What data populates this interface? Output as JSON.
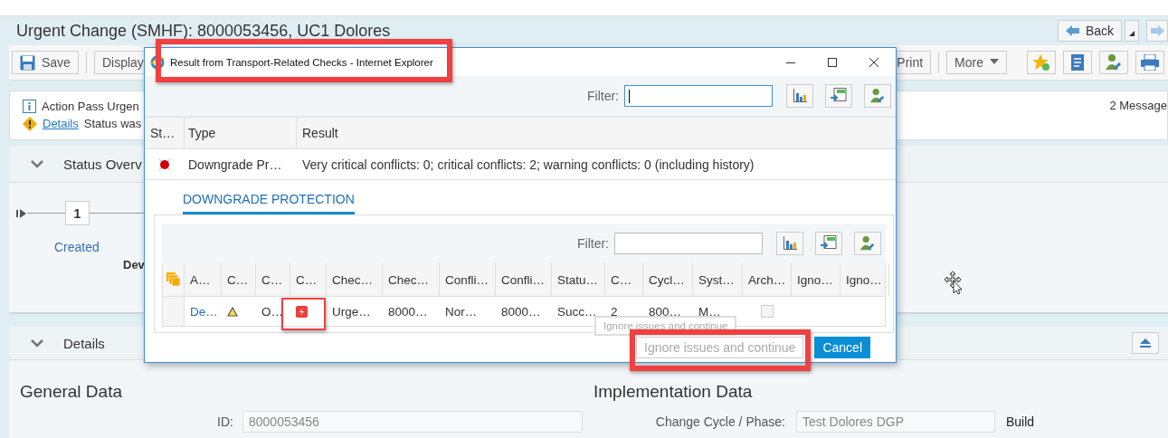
{
  "page": {
    "title": "Urgent Change (SMHF): 8000053456, UC1 Dolores",
    "navigation": {
      "back": "Back"
    },
    "toolbar": {
      "left": [
        {
          "label": "Save",
          "kind": "save"
        },
        {
          "label": "Display",
          "kind": "plain"
        }
      ],
      "right": [
        {
          "label": "Print",
          "kind": "plain"
        },
        {
          "label": "More",
          "kind": "menu"
        }
      ]
    },
    "messages": {
      "items": [
        {
          "kind": "info",
          "text": "Action Pass Urgen"
        },
        {
          "kind": "warning",
          "link": "Details",
          "text": "Status was"
        }
      ],
      "count": "2 Message"
    },
    "status_overview": {
      "title": "Status Overv",
      "expanded": true,
      "steps": [
        {
          "number": "1",
          "label": "Created"
        }
      ],
      "phase": "Dev"
    },
    "details": {
      "title": "Details",
      "expanded": true
    },
    "general_data": {
      "title": "General Data",
      "fields": [
        {
          "label": "ID:",
          "value": "8000053456"
        }
      ]
    },
    "implementation_data": {
      "title": "Implementation Data",
      "fields": [
        {
          "label": "Change Cycle / Phase:",
          "value": "Test Dolores DGP",
          "status": "Build"
        }
      ]
    }
  },
  "dialog": {
    "title": "Result from Transport-Related Checks - Internet Explorer",
    "filter": {
      "label": "Filter:",
      "focused": true
    },
    "results": {
      "columns": [
        "St…",
        "Type",
        "Result"
      ],
      "rows": [
        {
          "color": "#d10000",
          "type": "Downgrade Pr…",
          "result": "Very critical conflicts: 0; critical conflicts: 2; warning conflicts: 0 (including history)"
        }
      ]
    },
    "tabs": [
      {
        "label": "DOWNGRADE PROTECTION",
        "selected": true
      }
    ],
    "conflicts": {
      "filter": {
        "label": "Filter:",
        "focused": false
      },
      "columns": [
        "A…",
        "C…",
        "C…",
        "C…",
        "Chec…",
        "Chec…",
        "Confli…",
        "Confli…",
        "Statu…",
        "C…",
        "Cycl…",
        "Syst…",
        "Arch…",
        "Igno…",
        "Igno…"
      ],
      "rows": [
        {
          "cells": [
            {
              "kind": "link",
              "text": "De…"
            },
            {
              "kind": "warning"
            },
            {
              "kind": "text",
              "text": "O…"
            },
            {
              "kind": "critical"
            },
            {
              "kind": "text",
              "text": "Urge…"
            },
            {
              "kind": "text",
              "text": "8000…"
            },
            {
              "kind": "text",
              "text": "Nor…"
            },
            {
              "kind": "text",
              "text": "8000…"
            },
            {
              "kind": "text",
              "text": "Succ…"
            },
            {
              "kind": "text",
              "text": "2"
            },
            {
              "kind": "text",
              "text": "800…"
            },
            {
              "kind": "text",
              "text": "M…"
            },
            {
              "kind": "checkbox",
              "checked": false
            },
            {
              "kind": "empty"
            },
            {
              "kind": "empty"
            }
          ]
        }
      ]
    },
    "tooltip": "Ignore issues and continue",
    "buttons": [
      {
        "label": "Ignore issues and continue",
        "kind": "secondary",
        "disabled": true
      },
      {
        "label": "Cancel",
        "kind": "primary",
        "disabled": false
      }
    ]
  }
}
